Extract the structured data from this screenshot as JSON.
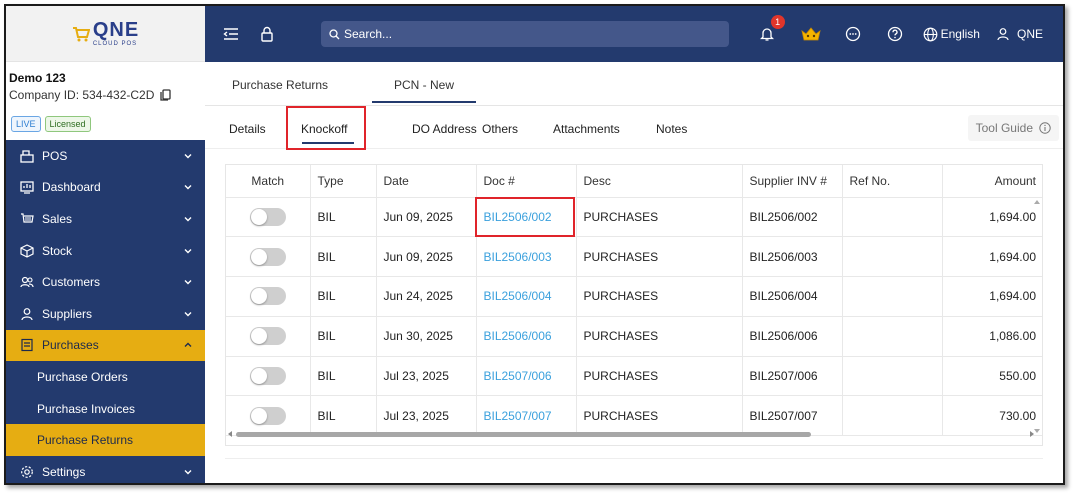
{
  "logo": {
    "main": "QNE",
    "sub": "CLOUD POS"
  },
  "company": {
    "name": "Demo 123",
    "id_label": "Company ID: 534-432-C2D"
  },
  "badges": {
    "live": "LIVE",
    "licensed": "Licensed"
  },
  "sidebar": {
    "items": [
      {
        "label": "POS",
        "icon": "pos-icon"
      },
      {
        "label": "Dashboard",
        "icon": "dashboard-icon"
      },
      {
        "label": "Sales",
        "icon": "sales-icon"
      },
      {
        "label": "Stock",
        "icon": "stock-icon"
      },
      {
        "label": "Customers",
        "icon": "customers-icon"
      },
      {
        "label": "Suppliers",
        "icon": "suppliers-icon"
      },
      {
        "label": "Purchases",
        "icon": "purchases-icon"
      },
      {
        "label": "Settings",
        "icon": "settings-icon"
      }
    ],
    "sub_items": [
      {
        "label": "Purchase Orders"
      },
      {
        "label": "Purchase Invoices"
      },
      {
        "label": "Purchase Returns"
      }
    ],
    "accent": "#e6ad12",
    "bg": "#233a6e"
  },
  "header": {
    "search_placeholder": "Search...",
    "notification_count": "1",
    "language": "English",
    "user": "QNE"
  },
  "doc_tabs": {
    "purchase_returns": "Purchase Returns",
    "pcn_new": "PCN - New"
  },
  "sub_tabs": {
    "details": "Details",
    "knockoff": "Knockoff",
    "do_address": "DO Address",
    "others": "Others",
    "attachments": "Attachments",
    "notes": "Notes",
    "tool_guide": "Tool Guide"
  },
  "table": {
    "headers": {
      "match": "Match",
      "type": "Type",
      "date": "Date",
      "doc": "Doc #",
      "desc": "Desc",
      "supplier_inv": "Supplier INV #",
      "ref": "Ref No.",
      "amount": "Amount"
    },
    "rows": [
      {
        "type": "BIL",
        "date": "Jun 09, 2025",
        "doc": "BIL2506/002",
        "desc": "PURCHASES",
        "supplier_inv": "BIL2506/002",
        "ref": "",
        "amount": "1,694.00"
      },
      {
        "type": "BIL",
        "date": "Jun 09, 2025",
        "doc": "BIL2506/003",
        "desc": "PURCHASES",
        "supplier_inv": "BIL2506/003",
        "ref": "",
        "amount": "1,694.00"
      },
      {
        "type": "BIL",
        "date": "Jun 24, 2025",
        "doc": "BIL2506/004",
        "desc": "PURCHASES",
        "supplier_inv": "BIL2506/004",
        "ref": "",
        "amount": "1,694.00"
      },
      {
        "type": "BIL",
        "date": "Jun 30, 2025",
        "doc": "BIL2506/006",
        "desc": "PURCHASES",
        "supplier_inv": "BIL2506/006",
        "ref": "",
        "amount": "1,086.00"
      },
      {
        "type": "BIL",
        "date": "Jul 23, 2025",
        "doc": "BIL2507/006",
        "desc": "PURCHASES",
        "supplier_inv": "BIL2507/006",
        "ref": "",
        "amount": "550.00"
      },
      {
        "type": "BIL",
        "date": "Jul 23, 2025",
        "doc": "BIL2507/007",
        "desc": "PURCHASES",
        "supplier_inv": "BIL2507/007",
        "ref": "",
        "amount": "730.00"
      }
    ]
  },
  "colors": {
    "link": "#3aa0dd",
    "highlight": "#e0242a",
    "notification": "#e0352b"
  }
}
